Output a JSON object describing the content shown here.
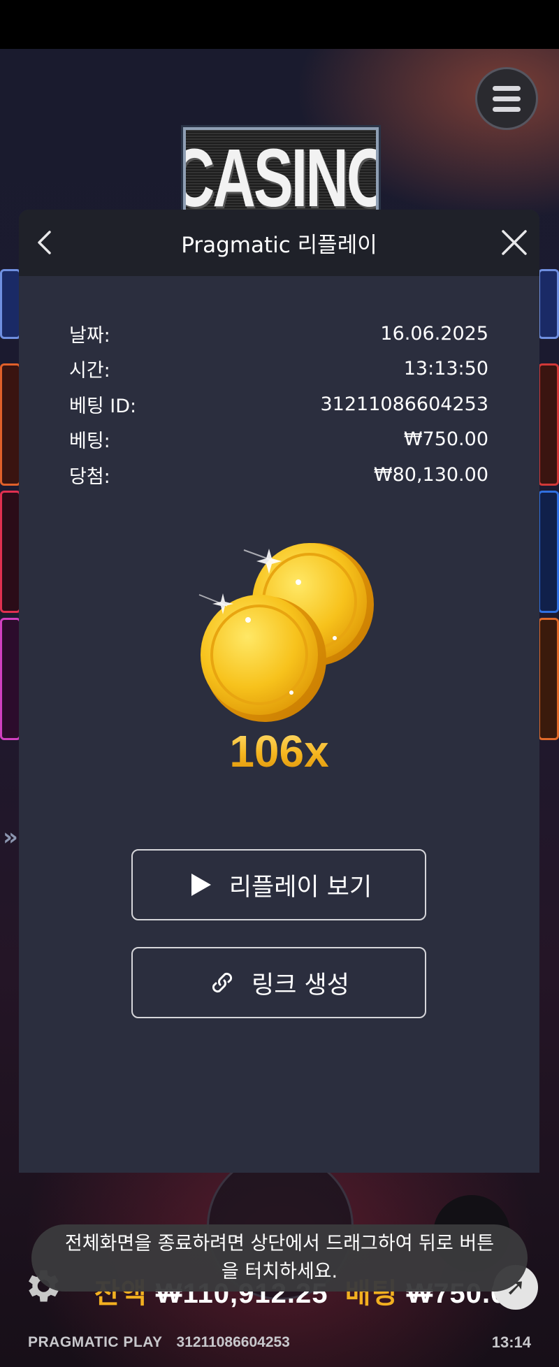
{
  "game": {
    "logo_text": "CASINO",
    "credit_label": "잔액",
    "credit_value": "₩110,912.25",
    "bet_label": "배팅",
    "bet_value": "₩750.00"
  },
  "footer": {
    "brand": "PRAGMATIC PLAY",
    "round_id": "31211086604253",
    "clock": "13:14"
  },
  "modal": {
    "title": "Pragmatic 리플레이",
    "rows": [
      {
        "label": "날짜:",
        "value": "16.06.2025"
      },
      {
        "label": "시간:",
        "value": "13:13:50"
      },
      {
        "label": "베팅 ID:",
        "value": "31211086604253"
      },
      {
        "label": "베팅:",
        "value": "₩750.00"
      },
      {
        "label": "당첨:",
        "value": "₩80,130.00"
      }
    ],
    "multiplier": "106x",
    "replay_button": "리플레이 보기",
    "link_button": "링크 생성"
  },
  "toast": {
    "message": "전체화면을 종료하려면 상단에서 드래그하여 뒤로 버튼을 터치하세요."
  },
  "colors": {
    "modal_bg": "#2b2e3e",
    "header_bg": "#1f2129",
    "gold": "#f5b51f"
  },
  "icons": [
    "menu-icon",
    "back-arrow-icon",
    "close-icon",
    "coins-icon",
    "play-icon",
    "link-icon",
    "gear-icon",
    "speed-icon"
  ]
}
